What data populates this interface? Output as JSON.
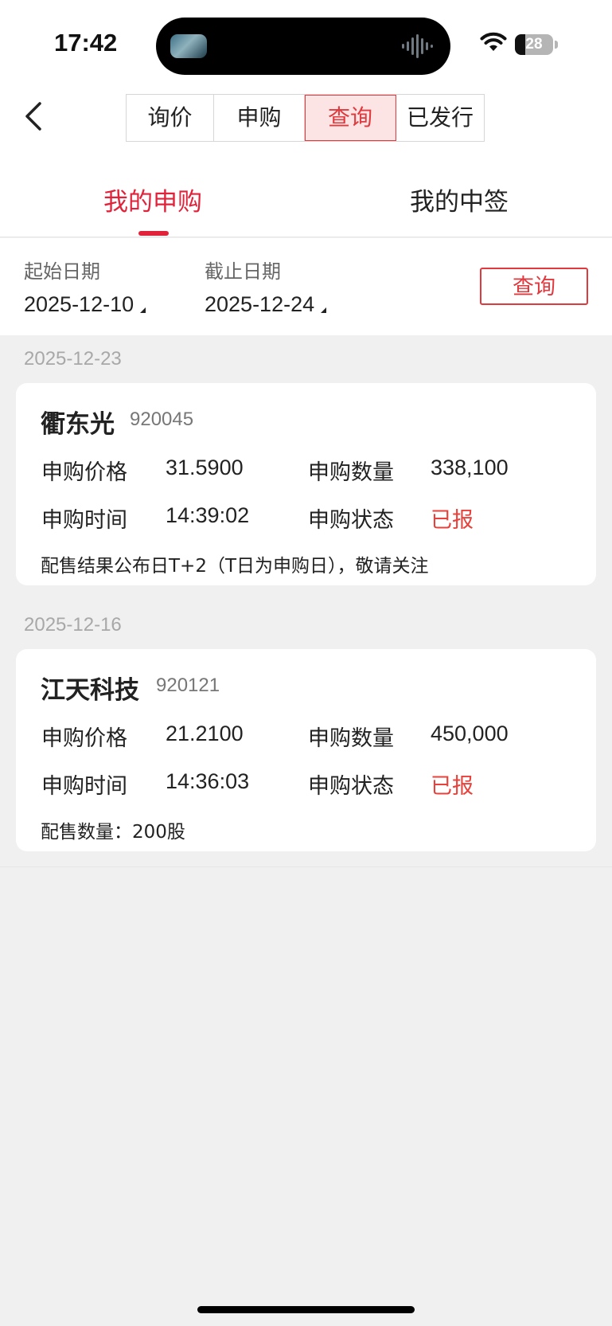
{
  "status_bar": {
    "time": "17:42",
    "battery": "28",
    "battery_level": 0.28
  },
  "nav": {
    "back_icon": "chevron-left-icon",
    "segments": [
      {
        "label": "询价"
      },
      {
        "label": "申购"
      },
      {
        "label": "查询",
        "active": true
      },
      {
        "label": "已发行"
      }
    ]
  },
  "tabs": [
    {
      "label": "我的申购",
      "active": true
    },
    {
      "label": "我的中签"
    }
  ],
  "filter": {
    "start_label": "起始日期",
    "start_value": "2025-12-10",
    "end_label": "截止日期",
    "end_value": "2025-12-24",
    "query_button": "查询"
  },
  "records": [
    {
      "date": "2025-12-23",
      "name": "衢东光",
      "code": "920045",
      "price_label": "申购价格",
      "price": "31.5900",
      "qty_label": "申购数量",
      "qty": "338,100",
      "time_label": "申购时间",
      "time": "14:39:02",
      "status_label": "申购状态",
      "status": "已报",
      "note": "配售结果公布日T+2（T日为申购日），敬请关注"
    },
    {
      "date": "2025-12-16",
      "name": "江天科技",
      "code": "920121",
      "price_label": "申购价格",
      "price": "21.2100",
      "qty_label": "申购数量",
      "qty": "450,000",
      "time_label": "申购时间",
      "time": "14:36:03",
      "status_label": "申购状态",
      "status": "已报",
      "note": "配售数量：200股"
    }
  ],
  "colors": {
    "accent": "#e0233b",
    "status_red": "#e8403a",
    "background": "#f0f0f0"
  }
}
